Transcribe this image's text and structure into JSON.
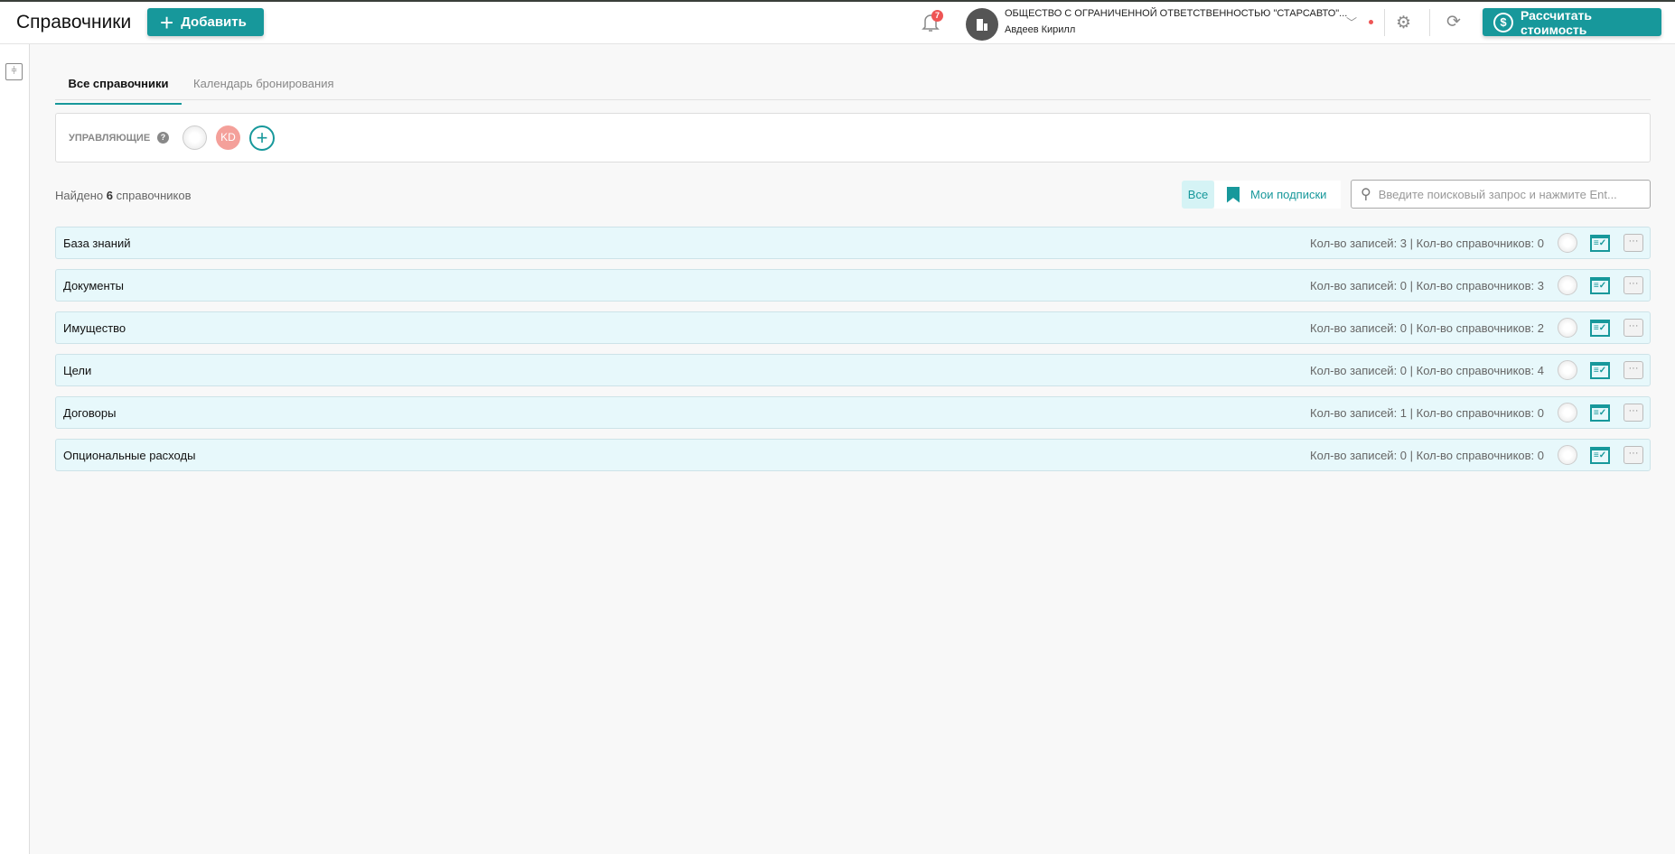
{
  "header": {
    "title": "Справочники",
    "add_label": "Добавить",
    "notifications_count": "7",
    "company": "ОБЩЕСТВО С ОГРАНИЧЕННОЙ ОТВЕТСТВЕННОСТЬЮ \"СТАРСАВТО\"...",
    "user": "Авдеев Кирилл",
    "calc_label": "Рассчитать стоимость",
    "accent": "#17989b"
  },
  "tabs": [
    {
      "label": "Все справочники",
      "active": true
    },
    {
      "label": "Календарь бронирования",
      "active": false
    }
  ],
  "managers": {
    "label": "УПРАВЛЯЮЩИЕ",
    "help": "?",
    "avatars": [
      "globe",
      "KD"
    ]
  },
  "found": {
    "prefix": "Найдено",
    "count": "6",
    "suffix": "справочников"
  },
  "filters": {
    "all": "Все",
    "subscriptions": "Мои подписки"
  },
  "search": {
    "placeholder": "Введите поисковый запрос и нажмите Ent..."
  },
  "rows": [
    {
      "name": "База знаний",
      "stats": "Кол-во записей: 3 | Кол-во справочников: 0"
    },
    {
      "name": "Документы",
      "stats": "Кол-во записей: 0 | Кол-во справочников: 3"
    },
    {
      "name": "Имущество",
      "stats": "Кол-во записей: 0 | Кол-во справочников: 2"
    },
    {
      "name": "Цели",
      "stats": "Кол-во записей: 0 | Кол-во справочников: 4"
    },
    {
      "name": "Договоры",
      "stats": "Кол-во записей: 1 | Кол-во справочников: 0"
    },
    {
      "name": "Опциональные расходы",
      "stats": "Кол-во записей: 0 | Кол-во справочников: 0"
    }
  ]
}
